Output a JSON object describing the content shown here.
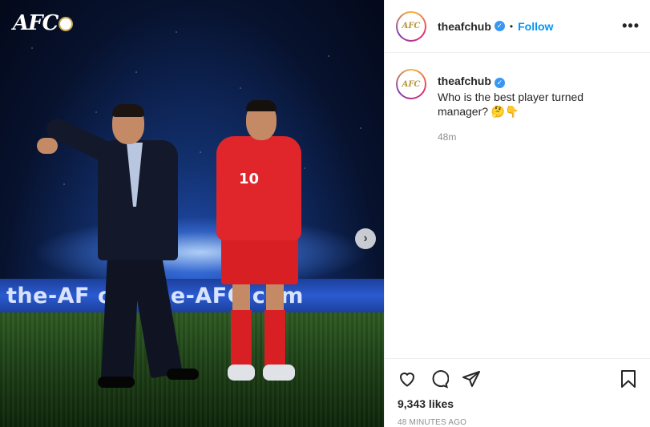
{
  "media": {
    "logo_text": "AFC",
    "banner_left": "the-AF",
    "banner_mid": "om",
    "banner_right": "the-AFC.com",
    "jersey_number": "10",
    "next_icon": "chevron-right-icon"
  },
  "header": {
    "username": "theafchub",
    "separator": "•",
    "follow_label": "Follow",
    "more_label": "•••",
    "avatar_text": "AFC"
  },
  "caption": {
    "username": "theafchub",
    "text": "Who is the best player turned manager? 🤔👇",
    "time": "48m"
  },
  "actions": {
    "like_icon": "heart-icon",
    "comment_icon": "comment-icon",
    "share_icon": "share-icon",
    "save_icon": "bookmark-icon",
    "likes": "9,343 likes",
    "posted_ago": "48 MINUTES AGO"
  }
}
